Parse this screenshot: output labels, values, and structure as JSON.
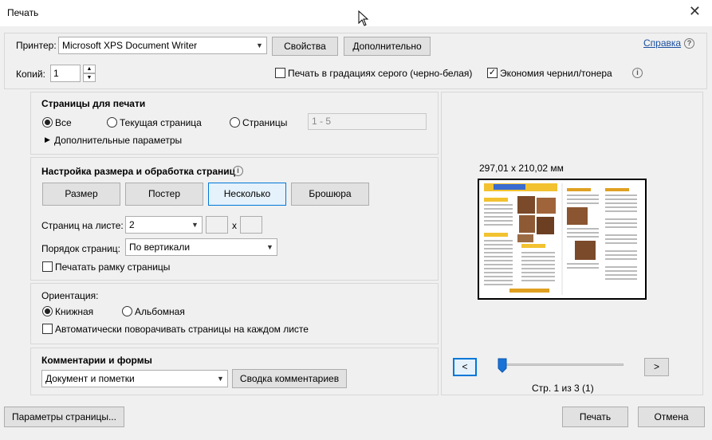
{
  "window": {
    "title": "Печать",
    "close_glyph": "✕"
  },
  "printer": {
    "label": "Принтер:",
    "selected": "Microsoft XPS Document Writer",
    "properties_button": "Свойства",
    "advanced_button": "Дополнительно",
    "help_link": "Справка",
    "copies_label": "Копий:",
    "copies_value": "1",
    "grayscale_label": "Печать в градациях серого (черно-белая)",
    "grayscale_checked": false,
    "save_ink_label": "Экономия чернил/тонера",
    "save_ink_checked": true
  },
  "pages": {
    "heading": "Страницы для печати",
    "all": "Все",
    "current": "Текущая страница",
    "pages": "Страницы",
    "range_placeholder": "1 - 5",
    "selected": "all",
    "more_options": "Дополнительные параметры"
  },
  "sizing": {
    "heading": "Настройка размера и обработка страниц",
    "tabs": [
      "Размер",
      "Постер",
      "Несколько",
      "Брошюра"
    ],
    "active_tab": "Несколько",
    "pages_per_sheet_label": "Страниц на листе:",
    "pages_per_sheet_value": "2",
    "x_sep": "x",
    "order_label": "Порядок страниц:",
    "order_value": "По вертикали",
    "border_label": "Печатать рамку страницы",
    "border_checked": false
  },
  "orientation": {
    "heading": "Ориентация:",
    "portrait": "Книжная",
    "landscape": "Альбомная",
    "selected": "portrait",
    "auto_rotate": "Автоматически поворачивать страницы на каждом листе",
    "auto_rotate_checked": false
  },
  "comments": {
    "heading": "Комментарии и формы",
    "selected": "Документ и пометки",
    "summary_button": "Сводка комментариев"
  },
  "preview": {
    "size": "297,01 x 210,02 мм",
    "page_label": "Стр. 1 из 3 (1)",
    "prev": "<",
    "next": ">",
    "slider_fraction": 0.0
  },
  "footer": {
    "page_setup": "Параметры страницы...",
    "print": "Печать",
    "cancel": "Отмена"
  }
}
